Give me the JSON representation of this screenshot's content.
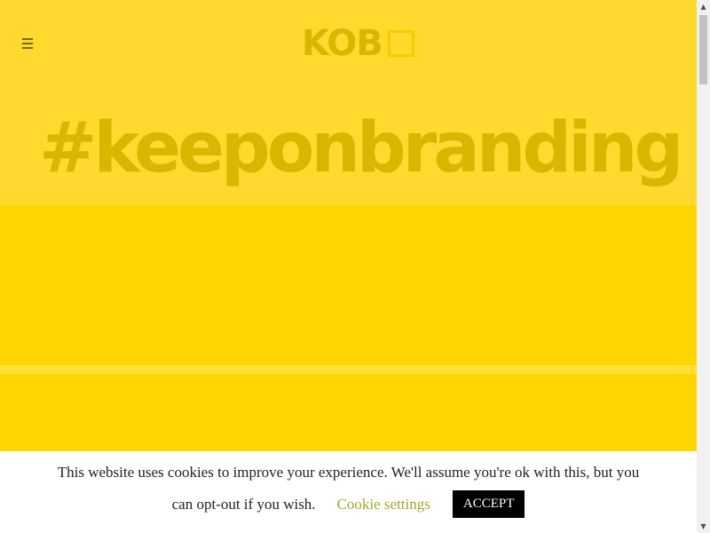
{
  "header": {
    "menu_icon": "hamburger-icon",
    "logo_text": "KOB",
    "hashtag": "#keeponbranding"
  },
  "cookie_banner": {
    "message_line1": "This website uses cookies to improve your experience. We'll assume you're ok with this, but you",
    "message_line2": "can opt-out if you wish.",
    "settings_label": "Cookie settings",
    "accept_label": "ACCEPT"
  },
  "scrollbar": {
    "up_icon": "▲",
    "down_icon": "▼"
  },
  "colors": {
    "background": "#ffd92e",
    "band": "#ffd500",
    "logo": "#d9b600",
    "cookie_link": "#a3a92e"
  }
}
